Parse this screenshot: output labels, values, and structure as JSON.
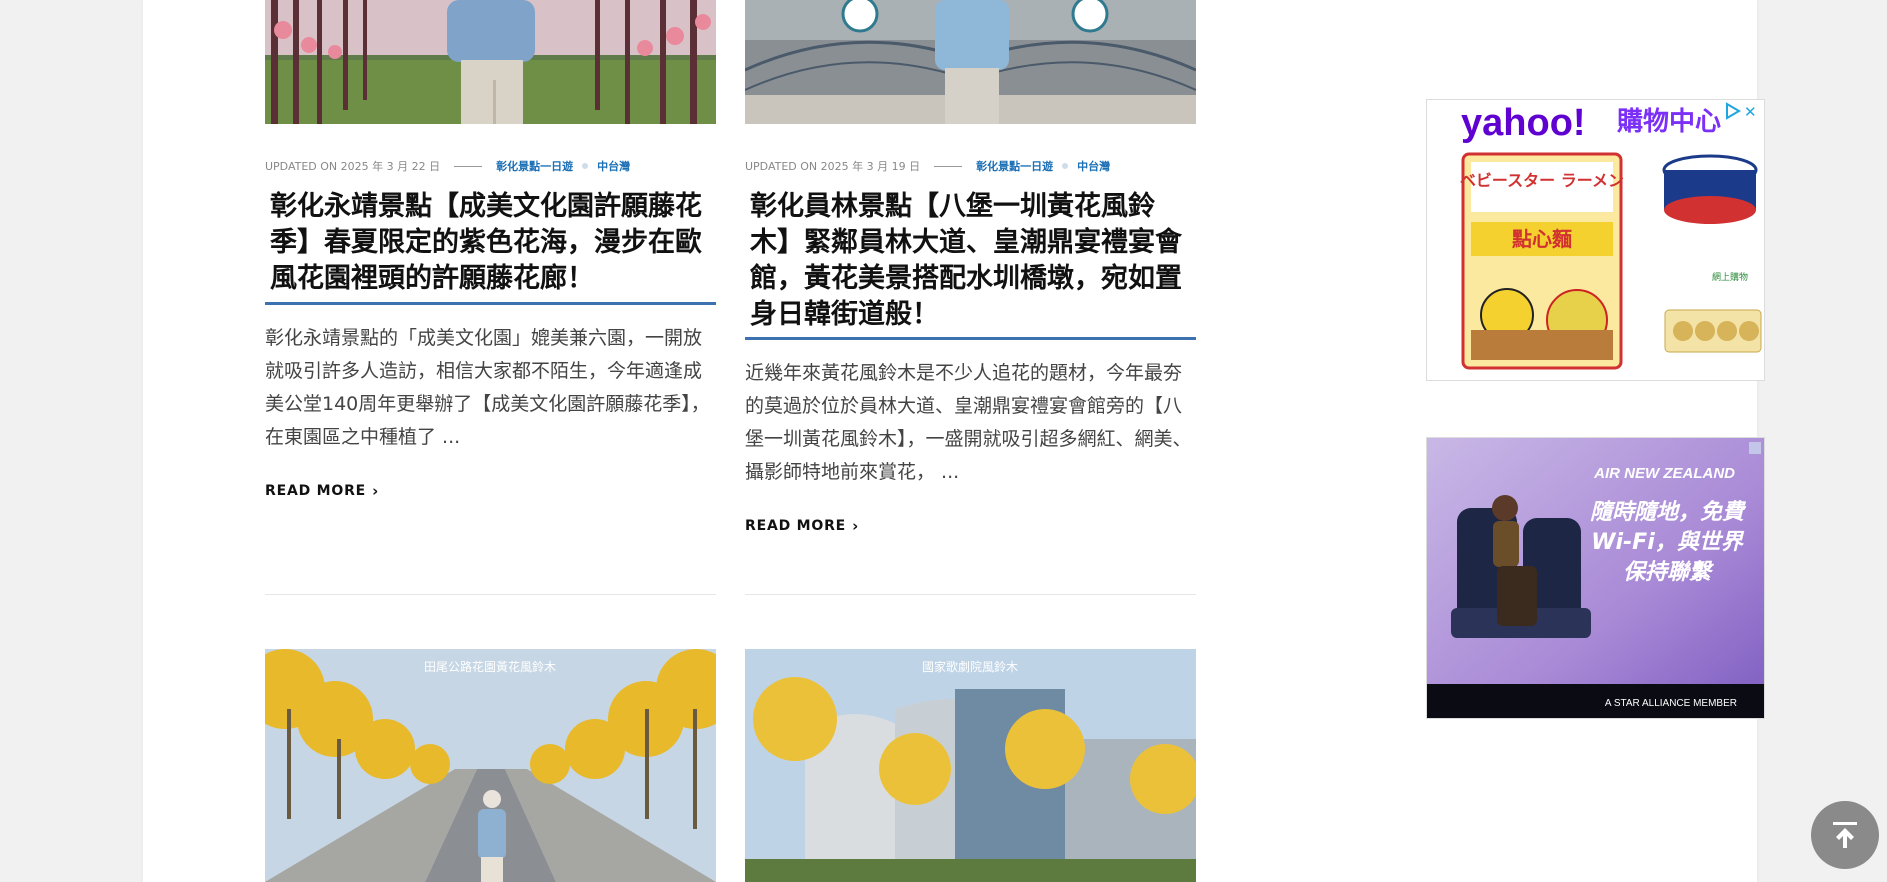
{
  "articles": [
    {
      "updated_label": "UPDATED ON 2025 年 3 月 22 日",
      "category_1": "彰化景點一日遊",
      "category_2": "中台灣",
      "title": "彰化永靖景點【成美文化園許願藤花季】春夏限定的紫色花海，漫步在歐風花園裡頭的許願藤花廊！",
      "excerpt": "彰化永靖景點的「成美文化園」媲美兼六園，一開放就吸引許多人造訪，相信大家都不陌生，今年適逢成美公堂140周年更舉辦了【成美文化園許願藤花季】，在東園區之中種植了 ...",
      "read_more": "READ MORE"
    },
    {
      "updated_label": "UPDATED ON 2025 年 3 月 19 日",
      "category_1": "彰化景點一日遊",
      "category_2": "中台灣",
      "title": "彰化員林景點【八堡一圳黃花風鈴木】緊鄰員林大道、皇潮鼎宴禮宴會館，黃花美景搭配水圳橋墩，宛如置身日韓街道般！",
      "excerpt": "近幾年來黃花風鈴木是不少人追花的題材，今年最夯的莫過於位於員林大道、皇潮鼎宴禮宴會館旁的【八堡一圳黃花風鈴木】，一盛開就吸引超多網紅、網美、攝影師特地前來賞花， ...",
      "read_more": "READ MORE"
    }
  ],
  "lower_thumbs": [
    {
      "caption": "田尾公路花園黃花風鈴木"
    },
    {
      "caption": "國家歌劇院風鈴木"
    }
  ],
  "ads": {
    "yahoo": {
      "brand": "yahoo!",
      "shop": "購物中心",
      "snack_text": "ベビースター ラーメン",
      "snack_cn": "點心麵",
      "small_text": "網上購物"
    },
    "airnz": {
      "brand": "AIR NEW ZEALAND",
      "headline": "隨時隨地，免費Wi-Fi，與世界保持聯繫",
      "footer": "A STAR ALLIANCE MEMBER"
    }
  },
  "colors": {
    "accent": "#1a6fb5",
    "title_rule": "#3c72b0",
    "page_bg": "#f1f1f1"
  }
}
